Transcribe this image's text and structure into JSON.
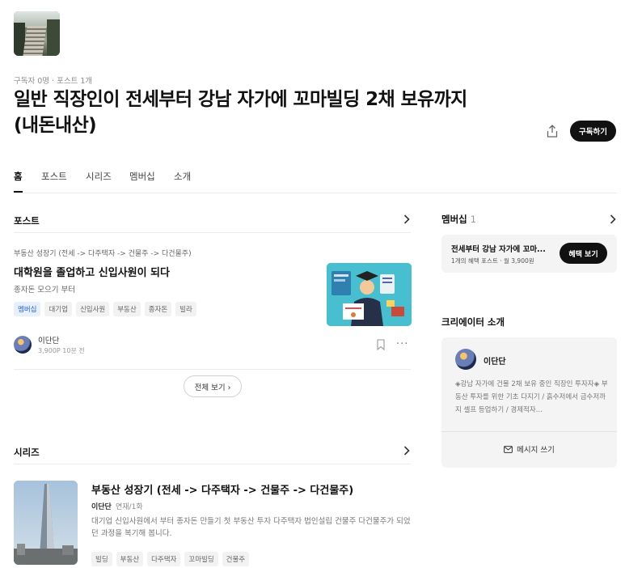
{
  "header": {
    "stats": "구독자 0명 · 포스트 1개",
    "title": "일반 직장인이 전세부터 강남 자가에 꼬마빌딩 2채 보유까지 (내돈내산)",
    "subscribe_label": "구독하기"
  },
  "tabs": [
    {
      "label": "홈"
    },
    {
      "label": "포스트"
    },
    {
      "label": "시리즈"
    },
    {
      "label": "멤버십"
    },
    {
      "label": "소개"
    }
  ],
  "posts_section": {
    "label": "포스트",
    "post": {
      "breadcrumb": "부동산 성장기 (전세 -> 다주택자 -> 건물주 -> 다건물주)",
      "title": "대학원을 졸업하고 신입사원이 되다",
      "subtitle": "종자돈 모으기 부터",
      "tags": [
        "멤버십",
        "대기업",
        "신입사원",
        "부동산",
        "종자돈",
        "빌라"
      ],
      "author": "이단단",
      "meta": "3,900P   10분 전"
    },
    "view_all_label": "전체 보기 ›"
  },
  "series_section": {
    "label": "시리즈",
    "series": {
      "title": "부동산 성장기 (전세 -> 다주택자 -> 건물주 -> 다건물주)",
      "author": "이단단",
      "count": "연재/1화",
      "description": "대기업 신입사원에서 부터 종자돈 만들기 첫 부동산 투자 다주택자 법인설립 건물주 다건물주가 되었던 과정을 복기해 봅니다.",
      "tags": [
        "빌딩",
        "부동산",
        "다주택자",
        "꼬마빌딩",
        "건물주"
      ]
    }
  },
  "membership": {
    "label": "멤버십",
    "count": "1",
    "card_title": "전세부터 강남 자가에 꼬마...",
    "card_sub": "1개의 혜택 포스트 · 월 3,900원",
    "benefit_label": "혜택 보기"
  },
  "creator": {
    "label": "크리에이터 소개",
    "name": "이단단",
    "description": "◈강남 자가에 건물 2채 보유 중인 직장인 투자자◈ 부동산 투자를 위한 기초 다지기 / 흙수저에서 금수저까지 셀프 등업하기 / 경제적자...",
    "message_label": "메시지 쓰기"
  },
  "colors": {
    "accent_blue": "#2463d6",
    "button_black": "#111111",
    "card_bg": "#f4f4f4"
  },
  "icons": [
    "share-icon",
    "chevron-right-icon",
    "bookmark-icon",
    "more-icon",
    "mail-icon"
  ]
}
